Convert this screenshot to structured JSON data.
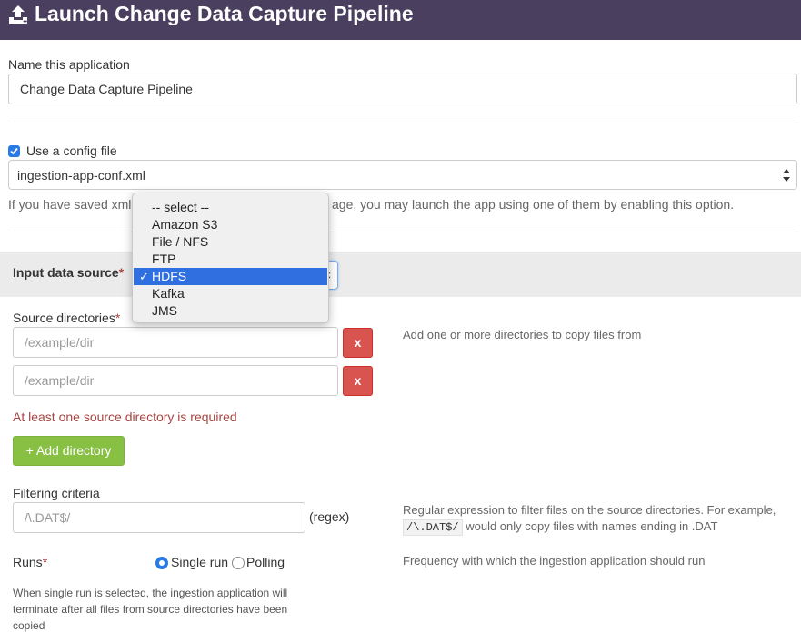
{
  "header": {
    "title": "Launch Change Data Capture Pipeline",
    "icon": "upload-icon"
  },
  "app_name": {
    "label": "Name this application",
    "value": "Change Data Capture Pipeline"
  },
  "config": {
    "checkbox_label": "Use a config file",
    "checked": true,
    "selected_file": "ingestion-app-conf.xml",
    "help_left": "If you have saved xml",
    "help_right": "age, you may launch the app using one of them by enabling this option."
  },
  "input_source": {
    "label": "Input data source",
    "required_mark": "*",
    "options": [
      "-- select --",
      "Amazon S3",
      "File / NFS",
      "FTP",
      "HDFS",
      "Kafka",
      "JMS"
    ],
    "selected": "HDFS",
    "check_mark": "✓"
  },
  "source_dirs": {
    "label": "Source directories",
    "required_mark": "*",
    "placeholder": "/example/dir",
    "remove_label": "x",
    "help": "Add one or more directories to copy files from",
    "error": "At least one source directory is required",
    "add_button": "+ Add directory"
  },
  "filtering": {
    "label": "Filtering criteria",
    "placeholder": "/\\.DAT$/",
    "suffix": "(regex)",
    "help_line1": "Regular expression to filter files on the source directories. For example,",
    "help_code": "/\\.DAT$/",
    "help_line2": " would only copy files with names ending in .DAT"
  },
  "runs": {
    "label": "Runs",
    "required_mark": "*",
    "single_label": "Single run",
    "polling_label": "Polling",
    "selected": "Single run",
    "help": "Frequency with which the ingestion application should run",
    "note": "When single run is selected, the ingestion application will terminate after all files from source directories have been copied"
  },
  "colors": {
    "header_bg": "#4a3f5e",
    "accent": "#2a7ae4",
    "danger": "#d9534f",
    "success": "#88c044"
  }
}
